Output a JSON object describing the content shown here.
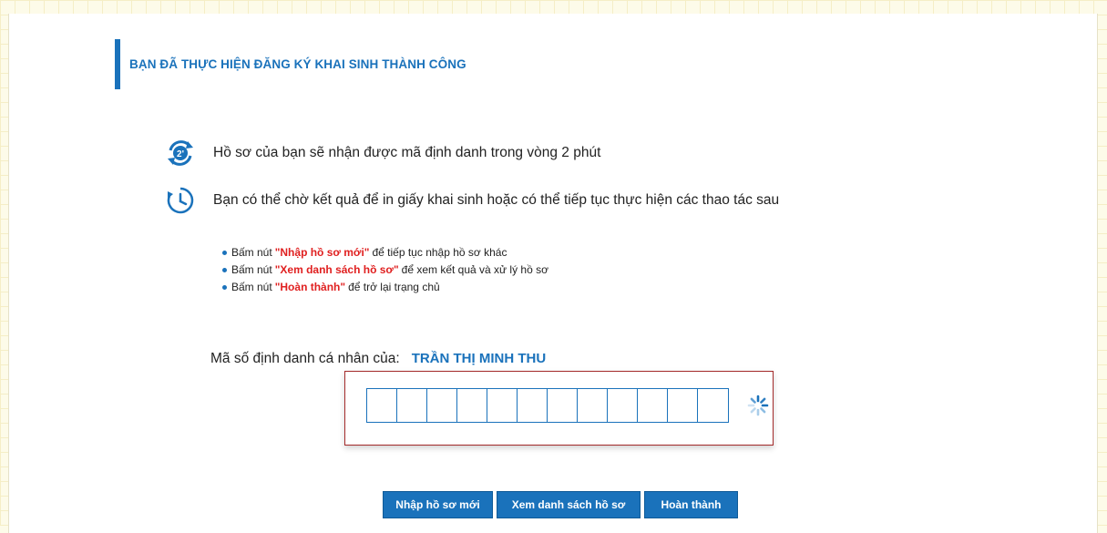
{
  "heading": "BẠN ĐÃ THỰC HIỆN ĐĂNG KÝ KHAI SINH THÀNH CÔNG",
  "info": {
    "line1": "Hồ sơ của bạn sẽ nhận được mã định danh trong vòng 2 phút",
    "line2": "Bạn có thể chờ kết quả để in giấy khai sinh hoặc có thể tiếp tục thực hiện các thao tác sau",
    "line1_icon": "refresh-2-minutes-icon",
    "line2_icon": "clock-icon"
  },
  "instructions": [
    {
      "prefix": "Bấm nút",
      "highlight": "\"Nhập hồ sơ mới\"",
      "suffix": "để tiếp tục nhập hồ sơ khác"
    },
    {
      "prefix": "Bấm nút",
      "highlight": "\"Xem danh sách hồ sơ\"",
      "suffix": "để xem kết quả và xử lý hồ sơ"
    },
    {
      "prefix": "Bấm nút",
      "highlight": "\"Hoàn thành\"",
      "suffix": "để trở lại trạng chủ"
    }
  ],
  "identity": {
    "label": "Mã số định danh cá nhân của:",
    "name": "TRẦN THỊ MINH THU",
    "digits": [
      "",
      "",
      "",
      "",
      "",
      "",
      "",
      "",
      "",
      "",
      "",
      ""
    ],
    "status_icon": "loading-spinner-icon"
  },
  "buttons": {
    "new_record": "Nhập hồ sơ mới",
    "view_list": "Xem danh sách hồ sơ",
    "done": "Hoàn thành"
  },
  "colors": {
    "accent": "#1a72bb",
    "highlight": "#e02020",
    "box_border": "#a32a2a",
    "page_background": "#fdfbe9"
  }
}
